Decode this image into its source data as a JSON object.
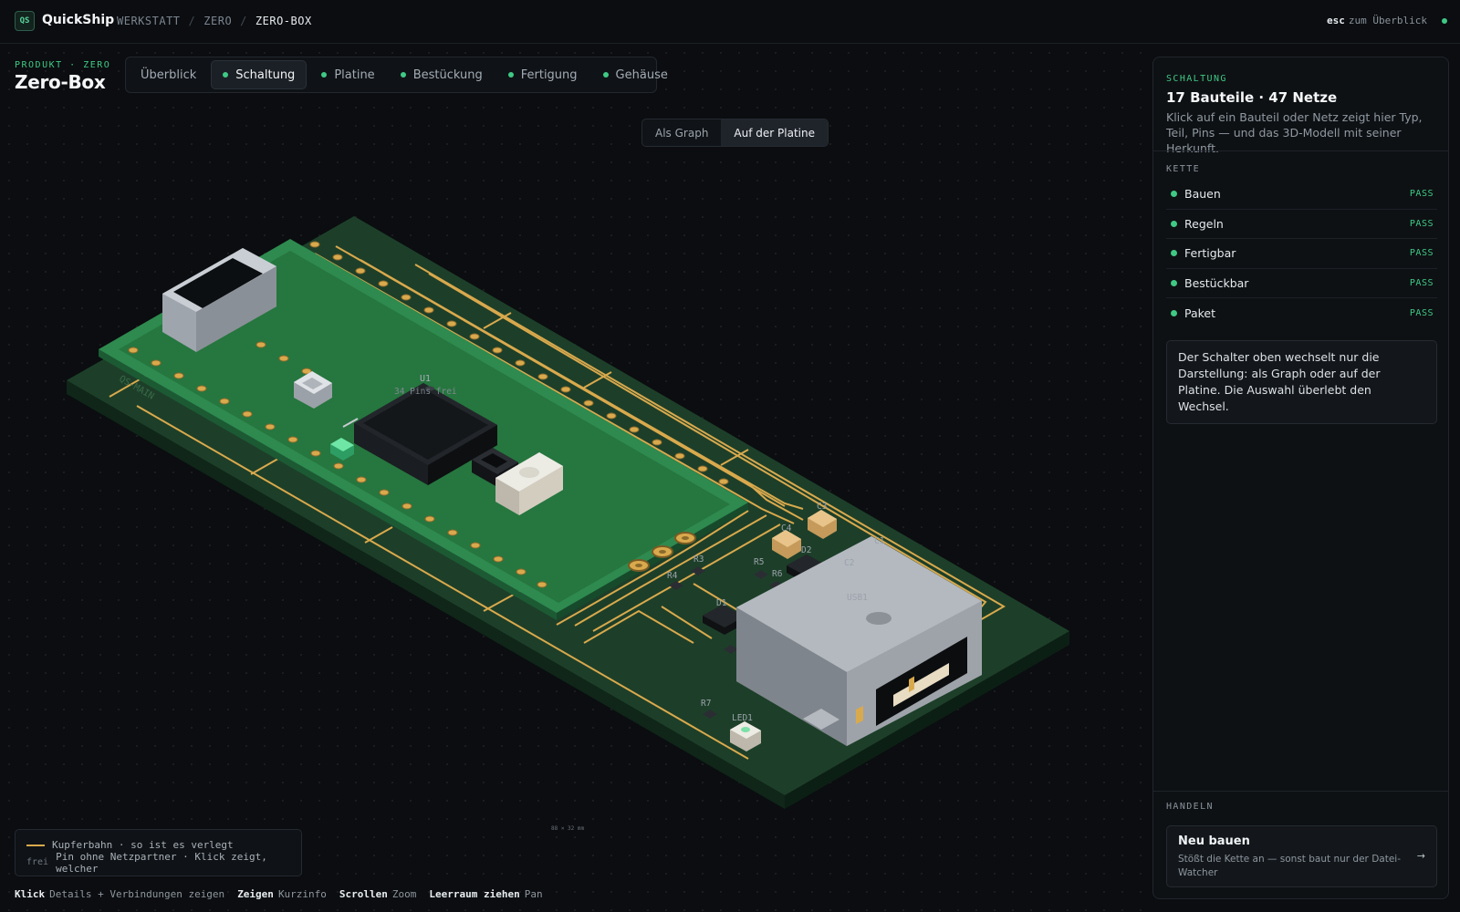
{
  "app": {
    "logo_text": "QS",
    "brand": "QuickShip",
    "breadcrumbs": [
      "WERKSTATT",
      "ZERO",
      "ZERO-BOX"
    ],
    "esc_key": "esc",
    "esc_text": "zum Überblick"
  },
  "product": {
    "label": "PRODUKT · ZERO",
    "title": "Zero-Box"
  },
  "tabs": [
    {
      "label": "Überblick",
      "dot": false,
      "active": false
    },
    {
      "label": "Schaltung",
      "dot": true,
      "active": true
    },
    {
      "label": "Platine",
      "dot": true,
      "active": false
    },
    {
      "label": "Bestückung",
      "dot": true,
      "active": false
    },
    {
      "label": "Fertigung",
      "dot": true,
      "active": false
    },
    {
      "label": "Gehäuse",
      "dot": true,
      "active": false
    }
  ],
  "view_toggle": {
    "graph": "Als Graph",
    "board": "Auf der Platine",
    "selected": "board"
  },
  "board": {
    "silk_text": "QS-MAIN",
    "u1_label": "U1",
    "u1_pins": "34 Pins frei",
    "usb_label": "USB1",
    "led_label": "LED1",
    "refs": [
      "C1",
      "C2",
      "C3",
      "C4",
      "D1",
      "D2",
      "R3",
      "R4",
      "R5",
      "R6",
      "R7"
    ],
    "scale": "88 × 32 mm",
    "colors": {
      "pcb": "#1e4a2e",
      "copper": "#d9a94d",
      "accent": "#3fc985"
    }
  },
  "legend": {
    "copper": "Kupferbahn · so ist es verlegt",
    "frei_tag": "frei",
    "frei_text": "Pin ohne Netzpartner · Klick zeigt, welcher"
  },
  "hints": [
    {
      "key": "Klick",
      "text": "Details + Verbindungen zeigen"
    },
    {
      "key": "Zeigen",
      "text": "Kurzinfo"
    },
    {
      "key": "Scrollen",
      "text": "Zoom"
    },
    {
      "key": "Leerraum ziehen",
      "text": "Pan"
    }
  ],
  "panel": {
    "section": "SCHALTUNG",
    "title": "17 Bauteile · 47 Netze",
    "description": "Klick auf ein Bauteil oder Netz zeigt hier Typ, Teil, Pins — und das 3D-Modell mit seiner Herkunft.",
    "chain_label": "KETTE",
    "chain": [
      {
        "name": "Bauen",
        "status": "PASS"
      },
      {
        "name": "Regeln",
        "status": "PASS"
      },
      {
        "name": "Fertigbar",
        "status": "PASS"
      },
      {
        "name": "Bestückbar",
        "status": "PASS"
      },
      {
        "name": "Paket",
        "status": "PASS"
      }
    ],
    "note": "Der Schalter oben wechselt nur die Darstellung: als Graph oder auf der Platine. Die Auswahl überlebt den Wechsel.",
    "handeln_label": "HANDELN",
    "action_title": "Neu bauen",
    "action_desc": "Stößt die Kette an — sonst baut nur der Datei-Watcher",
    "action_arrow": "→"
  }
}
